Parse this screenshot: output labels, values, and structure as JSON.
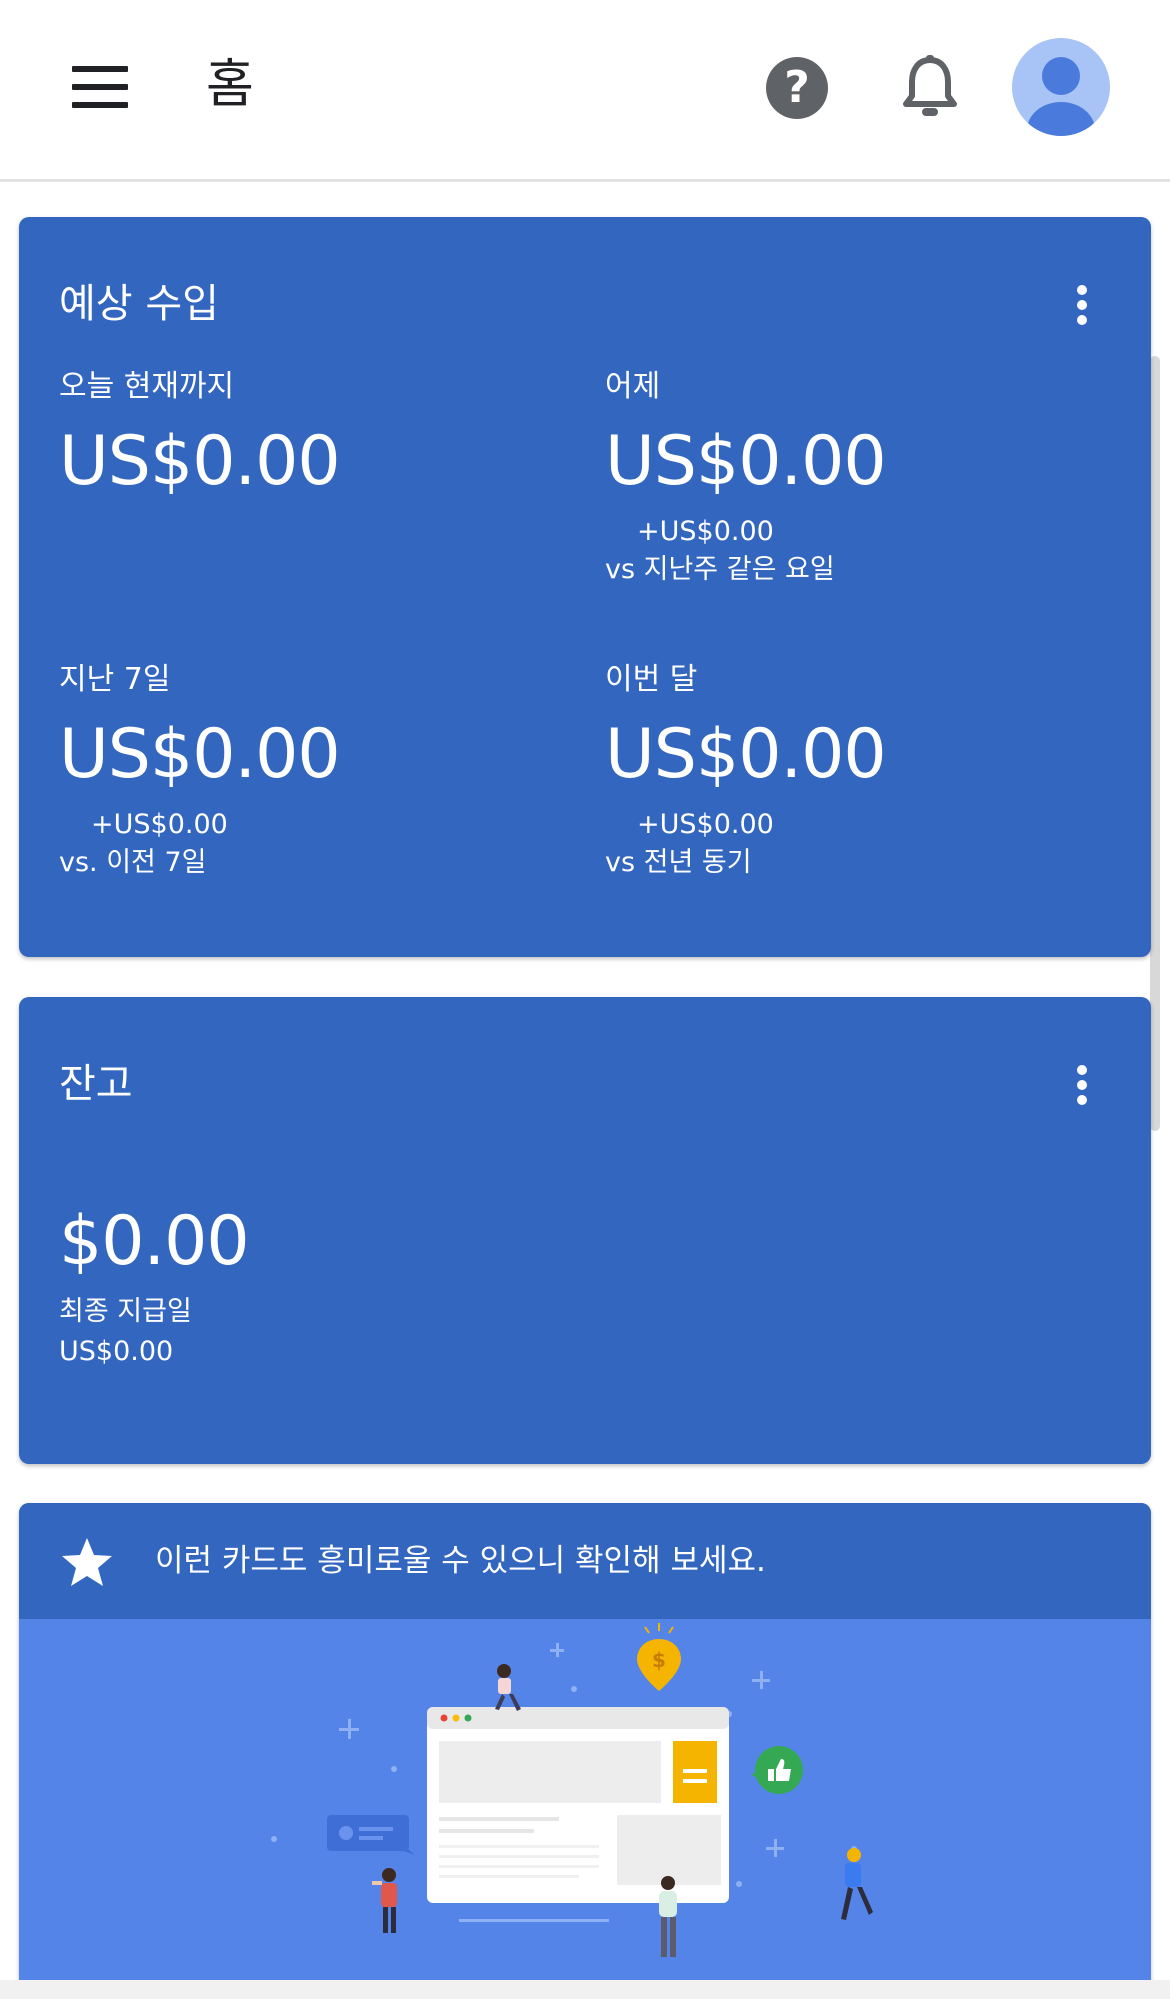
{
  "header": {
    "title": "홈"
  },
  "earnings": {
    "title": "예상 수입",
    "today": {
      "label": "오늘 현재까지",
      "value": "US$0.00"
    },
    "yesterday": {
      "label": "어제",
      "value": "US$0.00",
      "delta": "+US$0.00",
      "compare": "vs 지난주 같은 요일"
    },
    "last7": {
      "label": "지난 7일",
      "value": "US$0.00",
      "delta": "+US$0.00",
      "compare": "vs. 이전 7일"
    },
    "month": {
      "label": "이번 달",
      "value": "US$0.00",
      "delta": "+US$0.00",
      "compare": "vs 전년 동기"
    }
  },
  "balance": {
    "title": "잔고",
    "value": "$0.00",
    "last_payment_label": "최종 지급일",
    "last_payment_value": "US$0.00"
  },
  "promo": {
    "text": "이런 카드도 흥미로울 수 있으니 확인해 보세요.",
    "price_symbol": "$"
  },
  "colors": {
    "card": "#3366bf",
    "illustration_bg": "#5584e8",
    "accent_yellow": "#f4b400",
    "accent_green": "#34a853"
  },
  "icons": [
    "menu-icon",
    "help-icon",
    "bell-icon",
    "avatar-icon",
    "more-vert-icon",
    "star-icon",
    "thumbs-up-icon",
    "dollar-pin-icon"
  ]
}
